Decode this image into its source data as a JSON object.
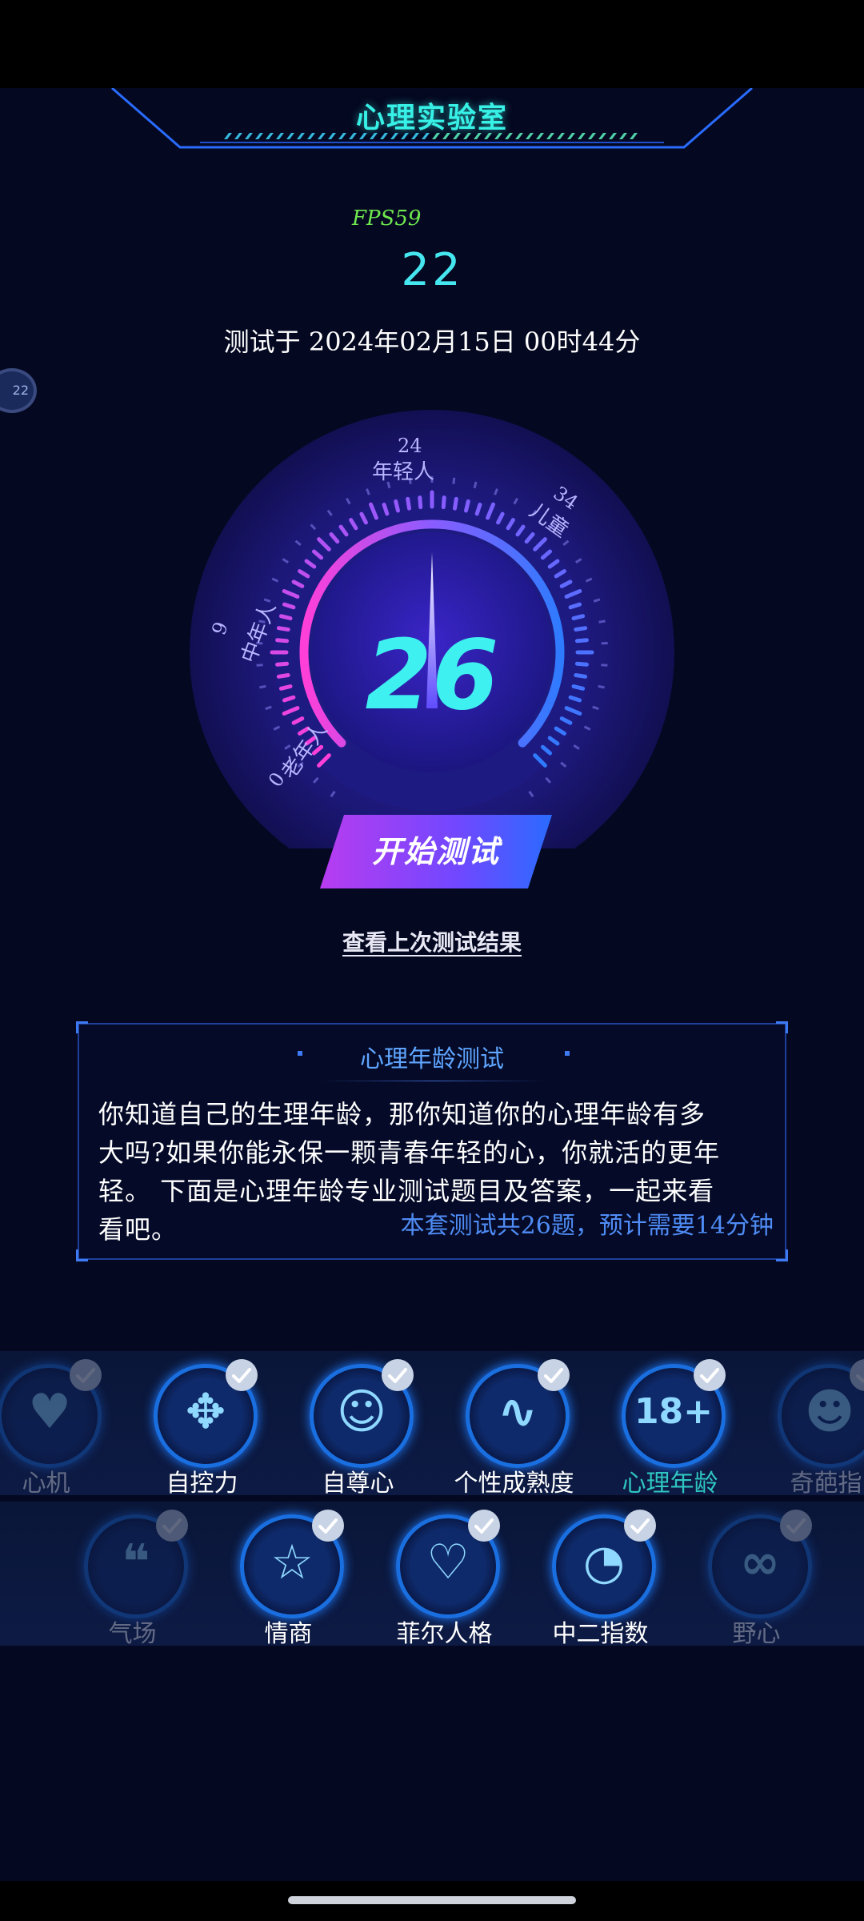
{
  "header": {
    "title": "心理实验室"
  },
  "fps": "FPS59",
  "age_small": "22",
  "test_date": "测试于 2024年02月15日 00时44分",
  "side_bubble": "22",
  "gauge": {
    "value": "26",
    "labels": {
      "top_number": "24",
      "top_text": "年轻人",
      "right_number": "34",
      "right_text": "儿童",
      "left_number": "9",
      "left_text": "中年人",
      "bottom_number": "0",
      "bottom_text": "老年人"
    },
    "colors": {
      "start": "#ff3fd8",
      "mid": "#8a5cff",
      "end": "#2f7bff",
      "bg": "#17166a",
      "value": "#3ef0f0"
    }
  },
  "start_button": {
    "label": "开始测试"
  },
  "last_result_link": "查看上次测试结果",
  "intro_card": {
    "title": "心理年龄测试",
    "desc_line1": "你知道自己的生理年龄，那你知道你的心理年龄有多",
    "desc_line2": "大吗?如果你能永保一颗青春年轻的心，你就活的更年",
    "desc_line3": "轻。 下面是心理年龄专业测试题目及答案，一起来看",
    "desc_line4": "看吧。",
    "meta": "本套测试共26题，预计需要14分钟"
  },
  "tests_row1": [
    {
      "label": "心机",
      "icon": "heart-pulse-icon"
    },
    {
      "label": "自控力",
      "icon": "control-pad-icon"
    },
    {
      "label": "自尊心",
      "icon": "smiley-icon"
    },
    {
      "label": "个性成熟度",
      "icon": "pulse-wave-icon"
    },
    {
      "label": "心理年龄",
      "icon": "eighteen-plus-icon"
    },
    {
      "label": "奇葩指",
      "icon": "wink-face-icon"
    }
  ],
  "tests_row2": [
    {
      "label": "气场",
      "icon": "speech-bubble-icon"
    },
    {
      "label": "情商",
      "icon": "star-face-icon"
    },
    {
      "label": "菲尔人格",
      "icon": "head-heart-icon"
    },
    {
      "label": "中二指数",
      "icon": "pacman-icon"
    },
    {
      "label": "野心",
      "icon": "wing-icon"
    }
  ]
}
